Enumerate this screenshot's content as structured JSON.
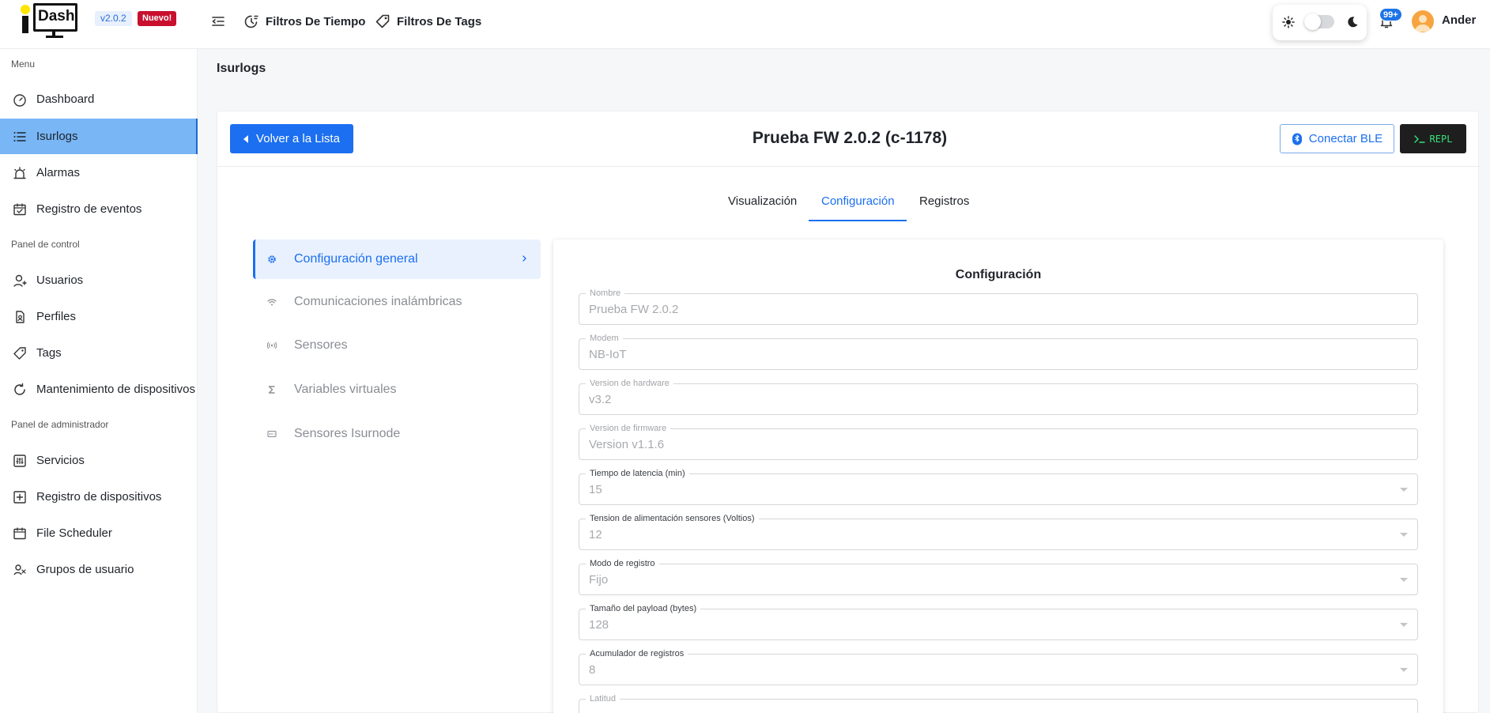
{
  "header": {
    "logo_text": "Dash",
    "version": "v2.0.2",
    "new_badge": "Nuevo!",
    "filters": [
      {
        "label": "Filtros De Tiempo",
        "icon": "clock-filter-icon"
      },
      {
        "label": "Filtros De Tags",
        "icon": "tag-icon"
      }
    ],
    "notifications_count": "99+",
    "user_name": "Ander"
  },
  "sidebar": {
    "section_menu": "Menu",
    "section_control": "Panel de control",
    "section_admin": "Panel de administrador",
    "items": [
      {
        "label": "Dashboard",
        "icon": "dashboard-icon"
      },
      {
        "label": "Isurlogs",
        "icon": "list-icon",
        "active": true
      },
      {
        "label": "Alarmas",
        "icon": "alarm-icon"
      },
      {
        "label": "Registro de eventos",
        "icon": "calendar-events-icon"
      },
      {
        "label": "Usuarios",
        "icon": "user-icon"
      },
      {
        "label": "Perfiles",
        "icon": "profile-icon"
      },
      {
        "label": "Tags",
        "icon": "tag-icon"
      },
      {
        "label": "Mantenimiento de dispositivos",
        "icon": "refresh-icon"
      },
      {
        "label": "Servicios",
        "icon": "services-icon"
      },
      {
        "label": "Registro de dispositivos",
        "icon": "add-box-icon"
      },
      {
        "label": "File Scheduler",
        "icon": "calendar-icon"
      },
      {
        "label": "Grupos de usuario",
        "icon": "users-group-icon"
      }
    ]
  },
  "page": {
    "title": "Isurlogs",
    "back_button": "Volver a la Lista",
    "device_title": "Prueba FW 2.0.2 (c-1178)",
    "ble_button": "Conectar BLE",
    "repl_button": "REPL",
    "tabs": [
      "Visualización",
      "Configuración",
      "Registros"
    ],
    "active_tab": "Configuración"
  },
  "config_nav": [
    {
      "label": "Configuración general",
      "icon": "gear-icon",
      "active": true
    },
    {
      "label": "Comunicaciones inalámbricas",
      "icon": "wifi-icon"
    },
    {
      "label": "Sensores",
      "icon": "sensor-icon"
    },
    {
      "label": "Variables virtuales",
      "icon": "sigma-icon"
    },
    {
      "label": "Sensores Isurnode",
      "icon": "node-icon"
    }
  ],
  "form": {
    "title": "Configuración",
    "fields": [
      {
        "label": "Nombre",
        "value": "Prueba FW 2.0.2"
      },
      {
        "label": "Modem",
        "value": "NB-IoT"
      },
      {
        "label": "Version de hardware",
        "value": "v3.2"
      },
      {
        "label": "Version de firmware",
        "value": "Version v1.1.6"
      },
      {
        "label": "Tiempo de latencia (min)",
        "value": "15"
      },
      {
        "label": "Tension de alimentación sensores (Voltios)",
        "value": "12"
      },
      {
        "label": "Modo de registro",
        "value": "Fijo"
      },
      {
        "label": "Tamaño del payload (bytes)",
        "value": "128"
      },
      {
        "label": "Acumulador de registros",
        "value": "8"
      },
      {
        "label": "Latitud",
        "value": ""
      }
    ]
  },
  "colors": {
    "primary": "#1b6ff0",
    "active_sidebar": "#78b6f6",
    "new_badge": "#c8102e",
    "repl_text": "#37e27a"
  }
}
